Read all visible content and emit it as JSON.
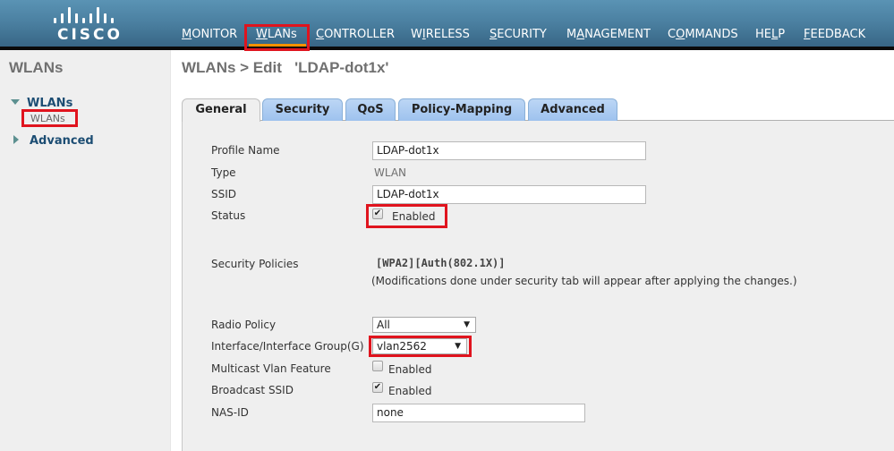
{
  "header": {
    "logo_text": "CISCO",
    "nav": [
      {
        "label": "MONITOR",
        "accesskey_index": 0
      },
      {
        "label": "WLANs",
        "accesskey_index": 0
      },
      {
        "label": "CONTROLLER",
        "accesskey_index": 0
      },
      {
        "label": "WIRELESS",
        "accesskey_index": 1
      },
      {
        "label": "SECURITY",
        "accesskey_index": 0
      },
      {
        "label": "MANAGEMENT",
        "accesskey_index": 1
      },
      {
        "label": "COMMANDS",
        "accesskey_index": 1
      },
      {
        "label": "HELP",
        "accesskey_index": 2
      },
      {
        "label": "FEEDBACK",
        "accesskey_index": 0
      }
    ],
    "active_nav": "WLANs"
  },
  "sidebar": {
    "title": "WLANs",
    "groups": [
      {
        "label": "WLANs",
        "expanded": true,
        "children": [
          {
            "label": "WLANs"
          }
        ]
      },
      {
        "label": "Advanced",
        "expanded": false
      }
    ]
  },
  "main": {
    "title": "WLANs > Edit   'LDAP-dot1x'",
    "tabs": [
      {
        "label": "General",
        "active": true
      },
      {
        "label": "Security"
      },
      {
        "label": "QoS"
      },
      {
        "label": "Policy-Mapping"
      },
      {
        "label": "Advanced"
      }
    ],
    "form": {
      "profile_name": {
        "label": "Profile Name",
        "value": "LDAP-dot1x"
      },
      "type": {
        "label": "Type",
        "value": "WLAN"
      },
      "ssid": {
        "label": "SSID",
        "value": "LDAP-dot1x"
      },
      "status": {
        "label": "Status",
        "checked": true,
        "checkbox_label": "Enabled"
      },
      "security_policies": {
        "label": "Security Policies",
        "value": "[WPA2][Auth(802.1X)]",
        "note": "(Modifications done under security tab will appear after applying the changes.)"
      },
      "radio_policy": {
        "label": "Radio Policy",
        "value": "All"
      },
      "interface": {
        "label": "Interface/Interface Group(G)",
        "value": "vlan2562"
      },
      "multicast_vlan": {
        "label": "Multicast Vlan Feature",
        "checked": false,
        "checkbox_label": "Enabled"
      },
      "broadcast_ssid": {
        "label": "Broadcast SSID",
        "checked": true,
        "checkbox_label": "Enabled"
      },
      "nas_id": {
        "label": "NAS-ID",
        "value": "none"
      }
    }
  },
  "colors": {
    "highlight": "#e0141e",
    "nav_active_underline": "#f39200",
    "tab_blue": "#9ec2ee",
    "sidebar_link": "#1c4d73"
  }
}
